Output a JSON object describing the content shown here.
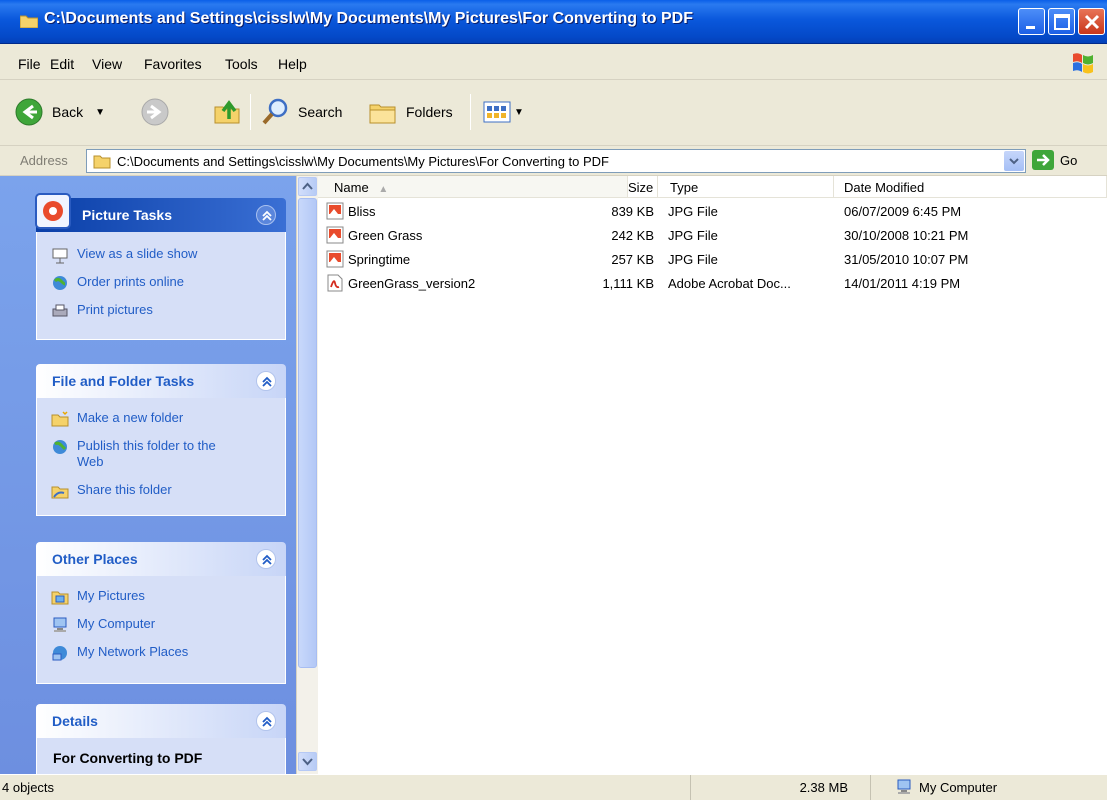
{
  "window": {
    "title": "C:\\Documents and Settings\\cisslw\\My Documents\\My Pictures\\For Converting to PDF"
  },
  "menu": [
    "File",
    "Edit",
    "View",
    "Favorites",
    "Tools",
    "Help"
  ],
  "toolbar": {
    "back_label": "Back",
    "search_label": "Search",
    "folders_label": "Folders"
  },
  "address": {
    "label": "Address",
    "value": "C:\\Documents and Settings\\cisslw\\My Documents\\My Pictures\\For Converting to PDF",
    "go_label": "Go"
  },
  "task_pane": {
    "picture_tasks": {
      "title": "Picture Tasks",
      "items": [
        "View as a slide show",
        "Order prints online",
        "Print pictures"
      ]
    },
    "file_folder_tasks": {
      "title": "File and Folder Tasks",
      "items": [
        "Make a new folder",
        "Publish this folder to the Web",
        "Share this folder"
      ]
    },
    "other_places": {
      "title": "Other Places",
      "items": [
        "My Pictures",
        "My Computer",
        "My Network Places"
      ]
    },
    "details": {
      "title": "Details",
      "name": "For Converting to PDF"
    }
  },
  "file_list": {
    "columns": [
      "Name",
      "Size",
      "Type",
      "Date Modified"
    ],
    "rows": [
      {
        "name": "Bliss",
        "size": "839 KB",
        "type": "JPG File",
        "date": "06/07/2009 6:45 PM",
        "icon": "jpg-file-icon"
      },
      {
        "name": "Green Grass",
        "size": "242 KB",
        "type": "JPG File",
        "date": "30/10/2008 10:21 PM",
        "icon": "jpg-file-icon"
      },
      {
        "name": "Springtime",
        "size": "257 KB",
        "type": "JPG File",
        "date": "31/05/2010 10:07 PM",
        "icon": "jpg-file-icon"
      },
      {
        "name": "GreenGrass_version2",
        "size": "1,111 KB",
        "type": "Adobe Acrobat Doc...",
        "date": "14/01/2011 4:19 PM",
        "icon": "pdf-file-icon"
      }
    ]
  },
  "status": {
    "objects": "4 objects",
    "size": "2.38 MB",
    "zone": "My Computer"
  }
}
